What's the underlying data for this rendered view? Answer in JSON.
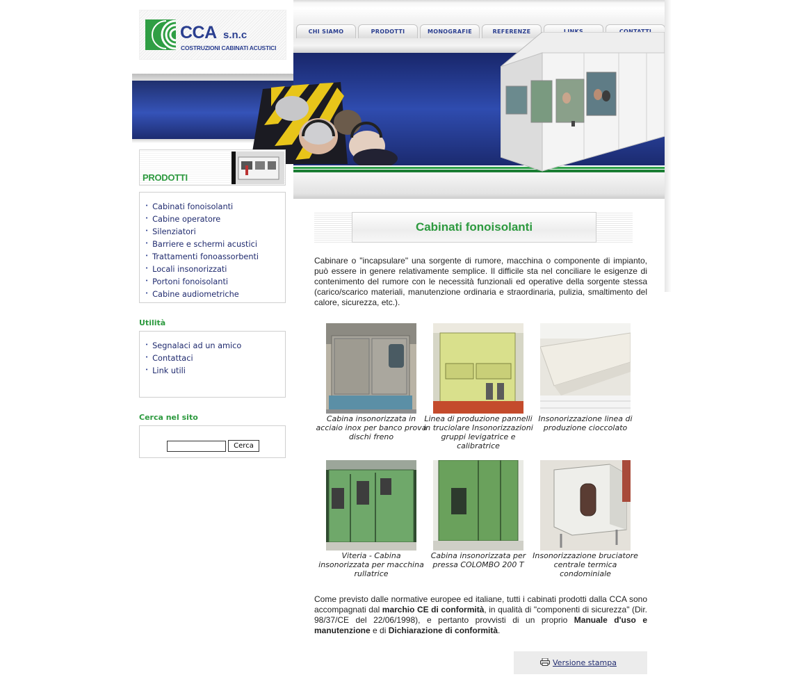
{
  "logo": {
    "name": "CCA",
    "suffix": "s.n.c",
    "tagline": "COSTRUZIONI CABINATI ACUSTICI"
  },
  "nav": [
    "CHI SIAMO",
    "PRODOTTI",
    "MONOGRAFIE",
    "REFERENZE",
    "LINKS",
    "CONTATTI"
  ],
  "sidebar": {
    "section_title": "PRODOTTI",
    "products": [
      "Cabinati fonoisolanti",
      "Cabine operatore",
      "Silenziatori",
      "Barriere e schermi acustici",
      "Trattamenti fonoassorbenti",
      "Locali insonorizzati",
      "Portoni fonoisolanti",
      "Cabine audiometriche"
    ],
    "utility_title": "Utilità",
    "utility": [
      "Segnalaci ad un amico",
      "Contattaci",
      "Link utili"
    ],
    "search_title": "Cerca nel sito",
    "search_button": "Cerca"
  },
  "content": {
    "title": "Cabinati fonoisolanti",
    "intro": "Cabinare o \"incapsulare\" una sorgente di rumore, macchina o componente di impianto, può essere in genere relativamente semplice. Il difficile sta nel conciliare le esigenze di contenimento del rumore con le necessità funzionali ed operative della sorgente stessa (carico/scarico materiali, manutenzione ordinaria e straordinaria, pulizia, smaltimento del calore, sicurezza, etc.).",
    "gallery": [
      {
        "caption": "Cabina insonorizzata in acciaio inox per banco prova dischi freno"
      },
      {
        "caption": "Linea di produzione pannelli in truciolare Insonorizzazioni gruppi levigatrice e calibratrice"
      },
      {
        "caption": "Insonorizzazione linea di produzione cioccolato"
      },
      {
        "caption": "Viteria - Cabina insonorizzata per macchina rullatrice"
      },
      {
        "caption": "Cabina insonorizzata per pressa COLOMBO 200 T"
      },
      {
        "caption": "Insonorizzazione bruciatore centrale termica condominiale"
      }
    ],
    "outro": {
      "p1": "Come previsto dalle normative europee ed italiane, tutti i cabinati prodotti dalla CCA sono accompagnati dal ",
      "b1": "marchio CE di conformità",
      "p2": ", in qualità di \"componenti di sicurezza\" (Dir. 98/37/CE del 22/06/1998), e pertanto provvisti di un proprio ",
      "b2": "Manuale d'uso e manutenzione",
      "p3": " e di ",
      "b3": "Dichiarazione di conformità",
      "p4": "."
    },
    "print_label": "Versione stampa"
  },
  "colors": {
    "brand_blue": "#2a3e8f",
    "brand_green": "#2d9a3f"
  }
}
